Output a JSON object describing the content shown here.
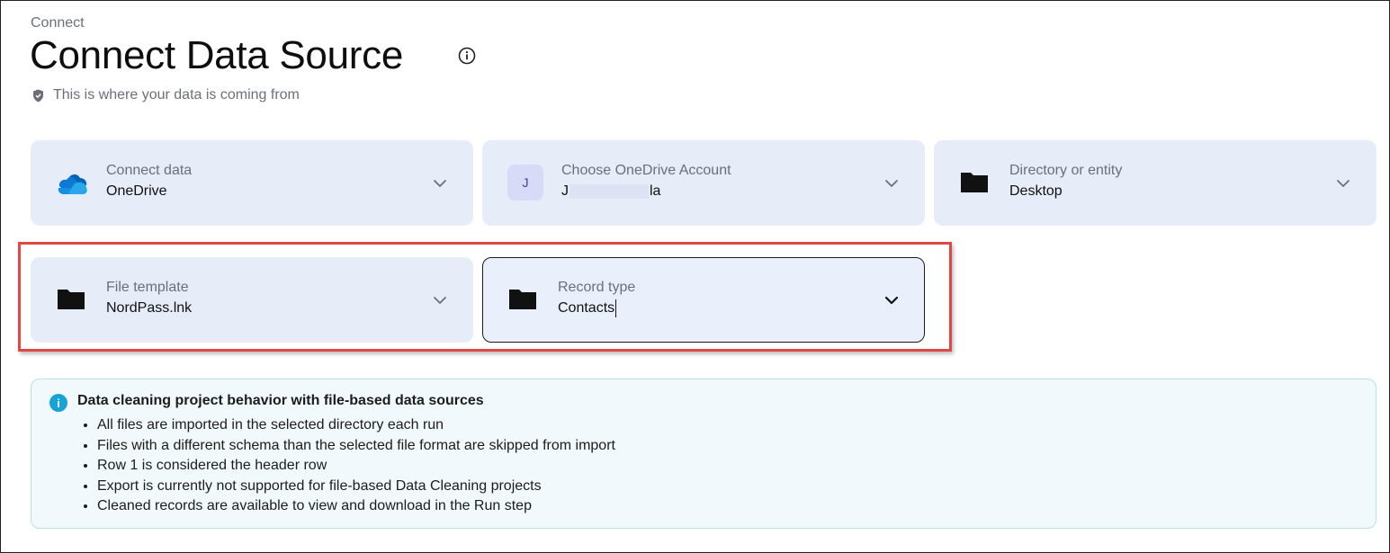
{
  "header": {
    "breadcrumb": "Connect",
    "title": "Connect Data Source",
    "subtitle": "This is where your data is coming from"
  },
  "cards": [
    {
      "label": "Connect data",
      "value": "OneDrive",
      "icon": "onedrive-icon"
    },
    {
      "label": "Choose OneDrive Account",
      "value_prefix": "J",
      "value_suffix": "la",
      "avatar": "J",
      "icon": "avatar"
    },
    {
      "label": "Directory or entity",
      "value": "Desktop",
      "icon": "folder-icon"
    },
    {
      "label": "File template",
      "value": "NordPass.lnk",
      "icon": "folder-icon"
    },
    {
      "label": "Record type",
      "value": "Contacts",
      "icon": "folder-icon"
    }
  ],
  "notice": {
    "title": "Data cleaning project behavior with file-based data sources",
    "items": [
      "All files are imported in the selected directory each run",
      "Files with a different schema than the selected file format are skipped from import",
      "Row 1 is considered the header row",
      "Export is currently not supported for file-based Data Cleaning projects",
      "Cleaned records are available to view and download in the Run step"
    ]
  },
  "colors": {
    "card_bg": "#e7ecf9",
    "highlight": "#e04848",
    "notice_bg": "#f2f9fc",
    "info_accent": "#17a2d8"
  }
}
